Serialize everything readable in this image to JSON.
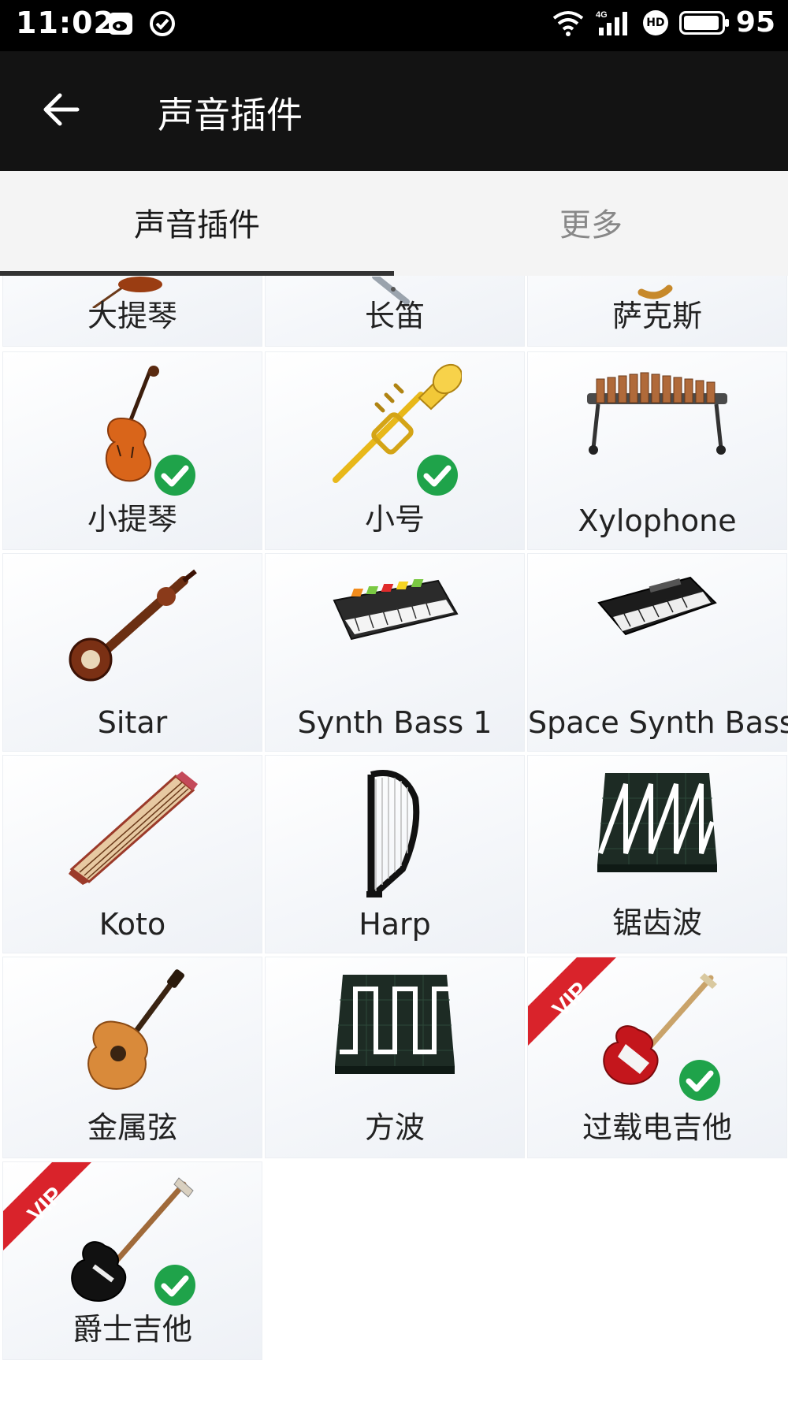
{
  "status_bar": {
    "time": "11:02",
    "battery": "95",
    "battery_level": 0.95
  },
  "toolbar": {
    "title": "声音插件"
  },
  "tabs": [
    {
      "label": "声音插件",
      "active": true
    },
    {
      "label": "更多",
      "active": false
    }
  ],
  "instruments": [
    {
      "label": "大提琴",
      "icon": "cello-icon",
      "selected": false,
      "vip": false
    },
    {
      "label": "长笛",
      "icon": "flute-icon",
      "selected": false,
      "vip": false
    },
    {
      "label": "萨克斯",
      "icon": "saxophone-icon",
      "selected": false,
      "vip": false
    },
    {
      "label": "小提琴",
      "icon": "violin-icon",
      "selected": true,
      "vip": false
    },
    {
      "label": "小号",
      "icon": "trumpet-icon",
      "selected": true,
      "vip": false
    },
    {
      "label": "Xylophone",
      "icon": "xylophone-icon",
      "selected": false,
      "vip": false
    },
    {
      "label": "Sitar",
      "icon": "sitar-icon",
      "selected": false,
      "vip": false
    },
    {
      "label": "Synth Bass 1",
      "icon": "synth-keyboard-icon",
      "selected": false,
      "vip": false
    },
    {
      "label": "Space Synth Bass",
      "icon": "synth-keyboard-dark-icon",
      "selected": false,
      "vip": false
    },
    {
      "label": "Koto",
      "icon": "koto-icon",
      "selected": false,
      "vip": false
    },
    {
      "label": "Harp",
      "icon": "harp-icon",
      "selected": false,
      "vip": false
    },
    {
      "label": "锯齿波",
      "icon": "sawtooth-wave-icon",
      "selected": false,
      "vip": false
    },
    {
      "label": "金属弦",
      "icon": "acoustic-guitar-icon",
      "selected": false,
      "vip": false
    },
    {
      "label": "方波",
      "icon": "square-wave-icon",
      "selected": false,
      "vip": false
    },
    {
      "label": "过载电吉他",
      "icon": "electric-guitar-icon",
      "selected": true,
      "vip": true
    },
    {
      "label": "爵士吉他",
      "icon": "jazz-guitar-icon",
      "selected": true,
      "vip": true
    }
  ],
  "vip_badge_text": "VIP",
  "colors": {
    "status_bar": "#000000",
    "toolbar": "#131313",
    "tab_bar": "#f4f4f4",
    "check_green": "#1fa34a",
    "vip_red": "#d9232b"
  }
}
